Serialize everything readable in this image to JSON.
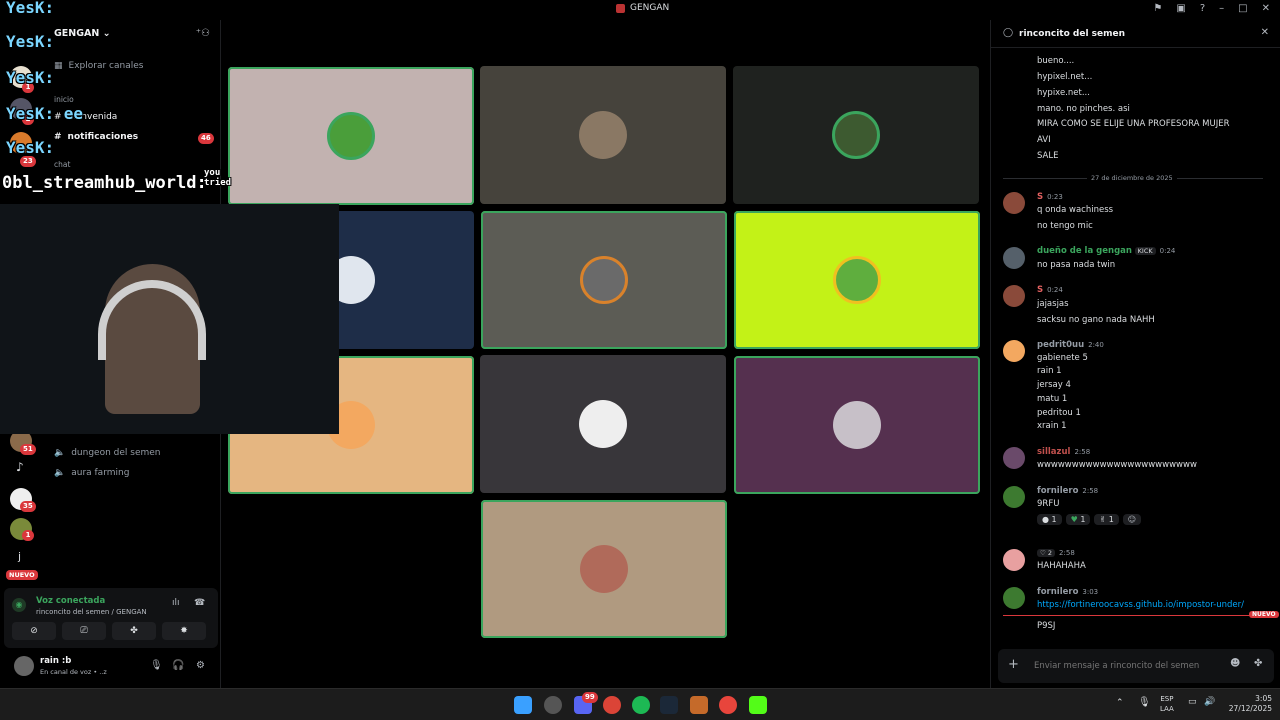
{
  "window": {
    "title": "GENGAN"
  },
  "server": {
    "name": "GENGAN",
    "explore": "Explorar canales",
    "section_label": "inicio",
    "channels": [
      "bienvenida",
      "notificaciones"
    ],
    "notif_count": "46",
    "chat_label": "chat",
    "voice_channels": [
      "dungeon del semen",
      "aura farming"
    ]
  },
  "rail_badges": [
    "1",
    "2",
    "23",
    "51",
    "35",
    "1"
  ],
  "rail_letter": "j",
  "rail_new": "NUEVO",
  "voice_panel": {
    "status": "Voz conectada",
    "location": "rinconcito del semen / GENGAN"
  },
  "user": {
    "name": "rain :b",
    "status": "En canal de voz • ..z"
  },
  "overlay": {
    "lines": [
      "YesK:",
      "YesK:",
      "YesK:",
      "YesK: ee",
      "YesK:",
      "0bl_streamhub_world:"
    ],
    "side_text": "you tried"
  },
  "chat": {
    "channel": "rinconcito del semen",
    "date_divider": "27 de diciembre de 2025",
    "top_lines": [
      "bueno....",
      "hypixel.net...",
      "hypixe.net...",
      "mano. no pinches. asi",
      "MIRA COMO SE ELIJE UNA PROFESORA MUJER",
      "AVI",
      "SALE"
    ],
    "messages": [
      {
        "user": "S",
        "time": "0:23",
        "lines": [
          "q onda wachiness",
          "no tengo mic"
        ]
      },
      {
        "user": "dueño de la gengan",
        "tag": "KICK",
        "time": "0:24",
        "lines": [
          "no pasa nada twin"
        ]
      },
      {
        "user": "S",
        "time": "0:24",
        "lines": [
          "jajasjas",
          "sacksu no gano nada NAHH"
        ]
      },
      {
        "user": "pedrit0uu",
        "time": "2:40",
        "lines": [
          "gabienete 5",
          "rain 1",
          "jersay 4",
          "matu 1",
          "pedritou 1",
          "xrain 1"
        ]
      },
      {
        "user": "sillazul",
        "time": "2:58",
        "lines": [
          "wwwwwwwwwwwwwwwwwwwwwww"
        ]
      },
      {
        "user": "fornilero",
        "time": "2:58",
        "lines": [
          "9RFU"
        ],
        "reactions": [
          "1",
          "1",
          "1"
        ]
      },
      {
        "user": "",
        "tag": "2",
        "time": "2:58",
        "lines": [
          "HAHAHAHA"
        ]
      },
      {
        "user": "fornilero",
        "time": "3:03",
        "link": "https://fortineroocavss.github.io/impostor-under/",
        "new_label": "NUEVO",
        "lines": [
          "P9SJ"
        ]
      }
    ],
    "input_placeholder": "Enviar mensaje a rinconcito del semen"
  },
  "taskbar": {
    "lang1": "ESP",
    "lang2": "LAA",
    "time": "3:05",
    "date": "27/12/2025",
    "discord_badge": "99"
  },
  "colors": {
    "accent_green": "#3ba55d",
    "danger": "#da373c",
    "link": "#00a8fc"
  }
}
